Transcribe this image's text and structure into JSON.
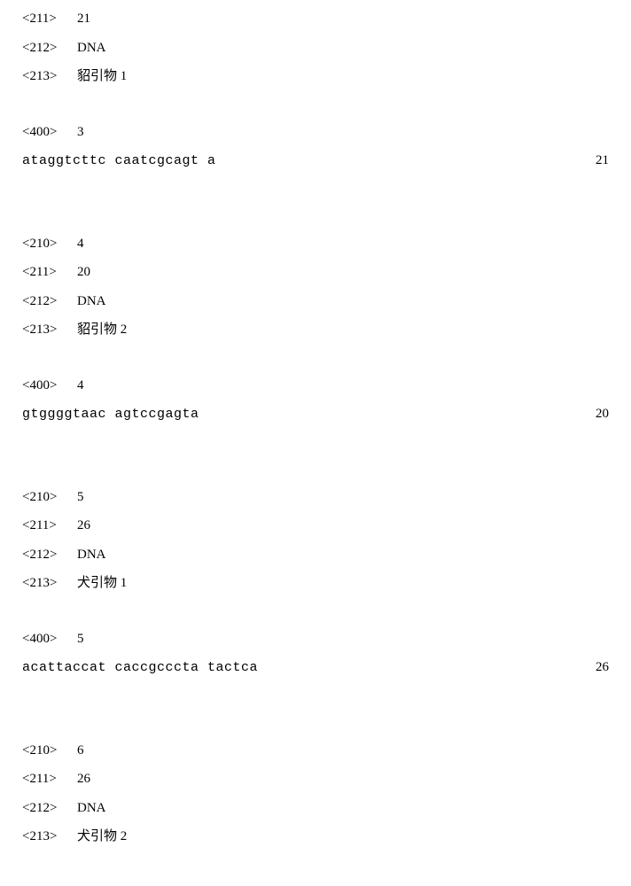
{
  "entries": [
    {
      "headers": [
        {
          "tag": "<211>",
          "value": "21"
        },
        {
          "tag": "<212>",
          "value": "DNA"
        },
        {
          "tag": "<213>",
          "value": "貂引物 1"
        }
      ],
      "header400": {
        "tag": "<400>",
        "value": "3"
      },
      "sequence": "ataggtcttc  caatcgcagt  a",
      "count": "21",
      "showHeaders": true
    },
    {
      "headers": [
        {
          "tag": "<210>",
          "value": "4"
        },
        {
          "tag": "<211>",
          "value": "20"
        },
        {
          "tag": "<212>",
          "value": "DNA"
        },
        {
          "tag": "<213>",
          "value": "貂引物 2"
        }
      ],
      "header400": {
        "tag": "<400>",
        "value": "4"
      },
      "sequence": "gtggggtaac  agtccgagta",
      "count": "20",
      "showHeaders": true
    },
    {
      "headers": [
        {
          "tag": "<210>",
          "value": "5"
        },
        {
          "tag": "<211>",
          "value": "26"
        },
        {
          "tag": "<212>",
          "value": "DNA"
        },
        {
          "tag": "<213>",
          "value": "犬引物 1"
        }
      ],
      "header400": {
        "tag": "<400>",
        "value": "5"
      },
      "sequence": "acattaccat  caccgcccta  tactca",
      "count": "26",
      "showHeaders": true
    },
    {
      "headers": [
        {
          "tag": "<210>",
          "value": "6"
        },
        {
          "tag": "<211>",
          "value": "26"
        },
        {
          "tag": "<212>",
          "value": "DNA"
        },
        {
          "tag": "<213>",
          "value": "犬引物 2"
        }
      ],
      "header400": null,
      "sequence": null,
      "count": null,
      "showHeaders": true
    }
  ]
}
